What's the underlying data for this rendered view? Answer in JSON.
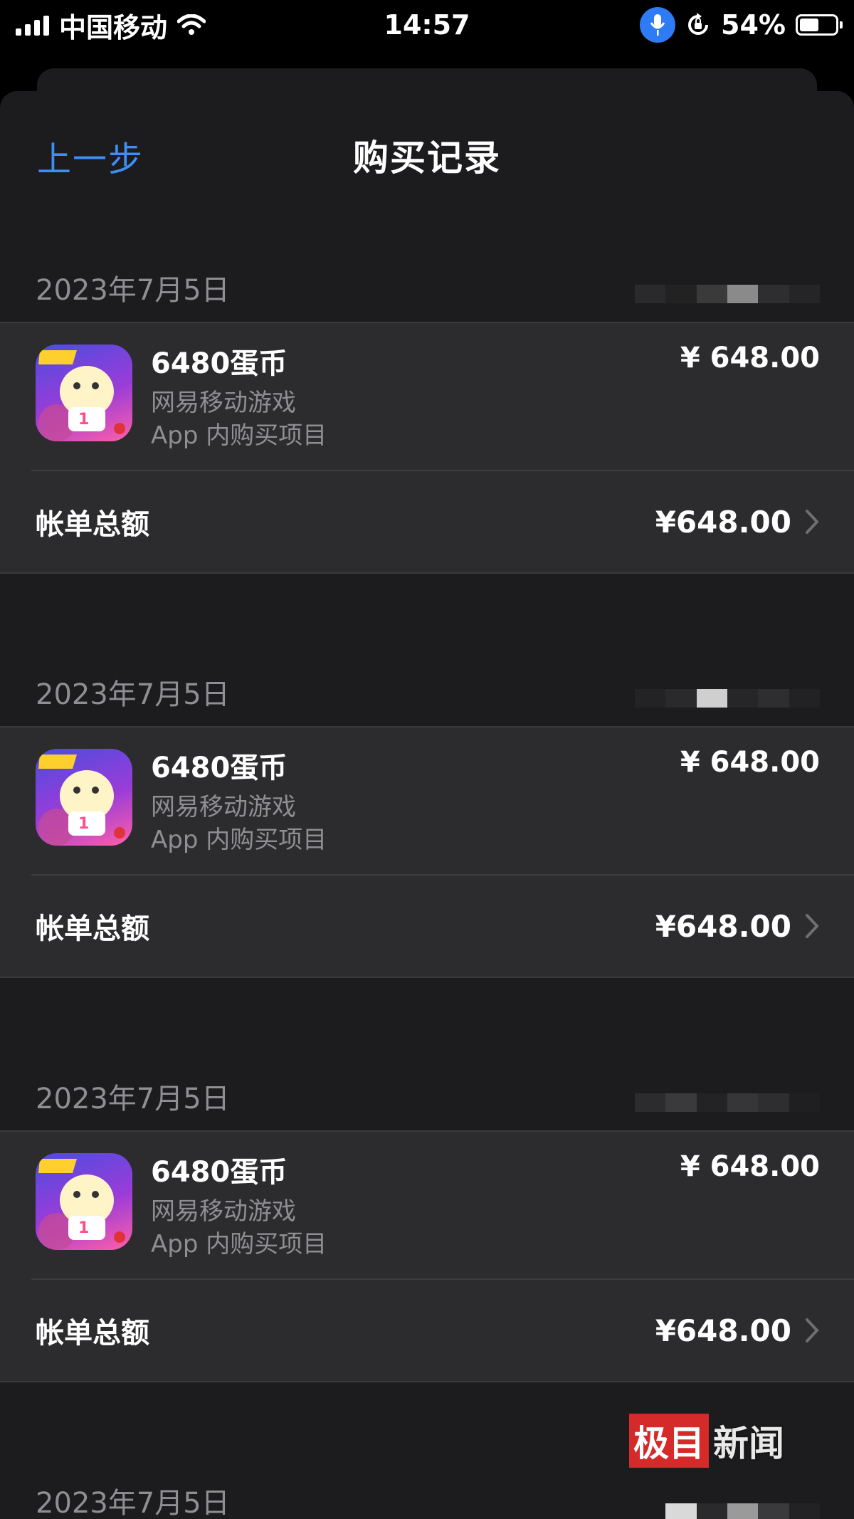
{
  "status_bar": {
    "carrier": "中国移动",
    "time": "14:57",
    "battery": "54%",
    "battery_level": 0.54
  },
  "nav": {
    "back_label": "上一步",
    "title": "购买记录"
  },
  "purchases": [
    {
      "date": "2023年7月5日",
      "item_name": "6480蛋币",
      "developer": "网易移动游戏",
      "type": "App 内购买项目",
      "price": "¥ 648.00",
      "total_label": "帐单总额",
      "total": "¥648.00"
    },
    {
      "date": "2023年7月5日",
      "item_name": "6480蛋币",
      "developer": "网易移动游戏",
      "type": "App 内购买项目",
      "price": "¥ 648.00",
      "total_label": "帐单总额",
      "total": "¥648.00"
    },
    {
      "date": "2023年7月5日",
      "item_name": "6480蛋币",
      "developer": "网易移动游戏",
      "type": "App 内购买项目",
      "price": "¥ 648.00",
      "total_label": "帐单总额",
      "total": "¥648.00"
    }
  ],
  "last_group": {
    "date": "2023年7月5日"
  },
  "watermark": {
    "part1": "极目",
    "part2": "新闻"
  },
  "colors": {
    "accent": "#3d8ff5",
    "sheet": "#1c1c1e",
    "card": "#2c2c2e",
    "secondary_text": "#8e8e93"
  }
}
